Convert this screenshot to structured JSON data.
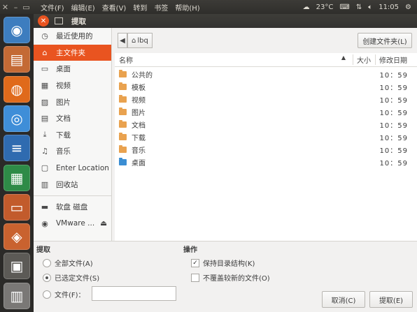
{
  "topbar": {
    "menus": [
      "文件(F)",
      "编辑(E)",
      "查看(V)",
      "转到",
      "书签",
      "帮助(H)"
    ],
    "temperature": "23°C",
    "time": "11:05"
  },
  "launcher": {
    "items": [
      {
        "name": "ubuntu-dash-icon",
        "color": "#3d7dbf",
        "glyph": "◉"
      },
      {
        "name": "file-manager-icon",
        "color": "#c46a35",
        "glyph": "▤"
      },
      {
        "name": "firefox-icon",
        "color": "#e06a1b",
        "glyph": "◍"
      },
      {
        "name": "chromium-icon",
        "color": "#3f8ed8",
        "glyph": "◎"
      },
      {
        "name": "libreoffice-writer-icon",
        "color": "#2f6bb0",
        "glyph": "≡"
      },
      {
        "name": "libreoffice-calc-icon",
        "color": "#2e8b47",
        "glyph": "▦"
      },
      {
        "name": "libreoffice-impress-icon",
        "color": "#c25b2c",
        "glyph": "▭"
      },
      {
        "name": "software-center-icon",
        "color": "#c9622f",
        "glyph": "◈"
      },
      {
        "name": "workspace-switcher-icon",
        "color": "#5c5a56",
        "glyph": "▣"
      },
      {
        "name": "trash-icon",
        "color": "#7a7876",
        "glyph": "▥"
      }
    ]
  },
  "dialog": {
    "title": "提取",
    "sidebar": [
      {
        "icon": "recent-icon",
        "glyph": "◷",
        "label": "最近使用的",
        "active": false
      },
      {
        "icon": "home-icon",
        "glyph": "⌂",
        "label": "主文件夹",
        "active": true
      },
      {
        "icon": "desktop-icon",
        "glyph": "▭",
        "label": "桌面",
        "active": false
      },
      {
        "icon": "video-icon",
        "glyph": "▦",
        "label": "视频",
        "active": false
      },
      {
        "icon": "picture-icon",
        "glyph": "▨",
        "label": "图片",
        "active": false
      },
      {
        "icon": "document-icon",
        "glyph": "▤",
        "label": "文档",
        "active": false
      },
      {
        "icon": "download-icon",
        "glyph": "⤓",
        "label": "下载",
        "active": false
      },
      {
        "icon": "music-icon",
        "glyph": "♫",
        "label": "音乐",
        "active": false
      },
      {
        "icon": "location-icon",
        "glyph": "▢",
        "label": "Enter Location",
        "active": false
      },
      {
        "icon": "trash-icon",
        "glyph": "▥",
        "label": "回收站",
        "active": false
      }
    ],
    "devices": [
      {
        "icon": "floppy-icon",
        "glyph": "▬",
        "label": "软盘 磁盘"
      },
      {
        "icon": "disc-icon",
        "glyph": "◉",
        "label": "VMware ..."
      }
    ],
    "path": "lbq",
    "new_folder_label": "创建文件夹(L)",
    "columns": {
      "name": "名称",
      "size": "大小",
      "modified": "修改日期"
    },
    "files": [
      {
        "name": "公共的",
        "time": "10：59",
        "type": "folder"
      },
      {
        "name": "模板",
        "time": "10：59",
        "type": "folder"
      },
      {
        "name": "视频",
        "time": "10：59",
        "type": "folder"
      },
      {
        "name": "图片",
        "time": "10：59",
        "type": "folder"
      },
      {
        "name": "文档",
        "time": "10：59",
        "type": "folder"
      },
      {
        "name": "下载",
        "time": "10：59",
        "type": "folder"
      },
      {
        "name": "音乐",
        "time": "10：59",
        "type": "folder"
      },
      {
        "name": "桌面",
        "time": "10：59",
        "type": "desktop"
      }
    ],
    "extract_section": {
      "title": "提取",
      "all_files": "全部文件(A)",
      "selected_files": "已选定文件(S)",
      "files_label": "文件(F)：",
      "files_value": ""
    },
    "actions_section": {
      "title": "操作",
      "keep_structure": "保持目录结构(K)",
      "keep_structure_checked": true,
      "no_overwrite": "不覆盖较新的文件(O)",
      "no_overwrite_checked": false
    },
    "cancel_label": "取消(C)",
    "extract_label": "提取(E)"
  }
}
